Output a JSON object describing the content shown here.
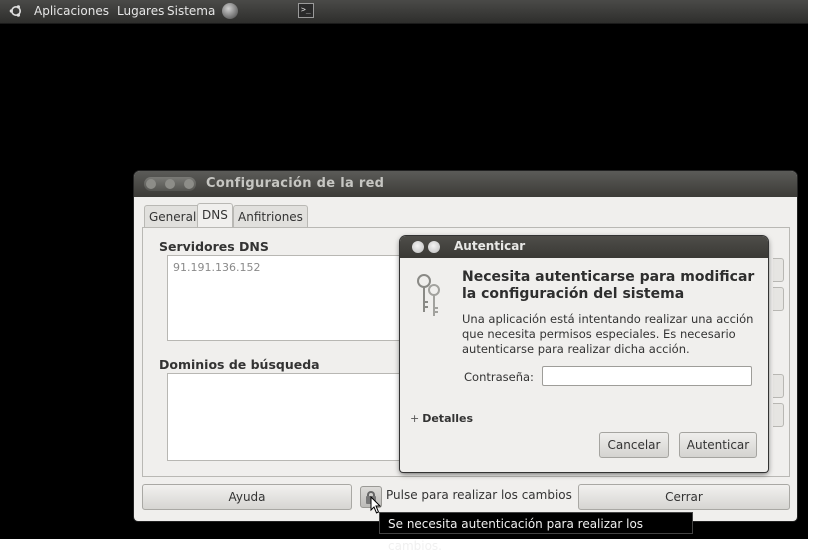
{
  "panel": {
    "menus": [
      "Aplicaciones",
      "Lugares",
      "Sistema"
    ]
  },
  "network_window": {
    "title": "Configuración de la red",
    "tabs": [
      {
        "label": "General",
        "active": false
      },
      {
        "label": "DNS",
        "active": true
      },
      {
        "label": "Anfitriones",
        "active": false
      }
    ],
    "dns_servers_label": "Servidores DNS",
    "dns_servers": [
      "91.191.136.152"
    ],
    "search_domains_label": "Dominios de búsqueda",
    "help_button": "Ayuda",
    "changes_label": "Pulse para realizar los cambios",
    "close_button": "Cerrar"
  },
  "auth_dialog": {
    "title": "Autenticar",
    "heading": "Necesita autenticarse para modificar la configuración del sistema",
    "description": "Una aplicación está intentando realizar una acción que necesita permisos especiales. Es necesario autenticarse para realizar dicha acción.",
    "password_label": "Contraseña:",
    "password_value": "",
    "details_label": "Detalles",
    "cancel_button": "Cancelar",
    "authenticate_button": "Autenticar"
  },
  "tooltip": {
    "text": "Se necesita autenticación para realizar los cambios."
  }
}
